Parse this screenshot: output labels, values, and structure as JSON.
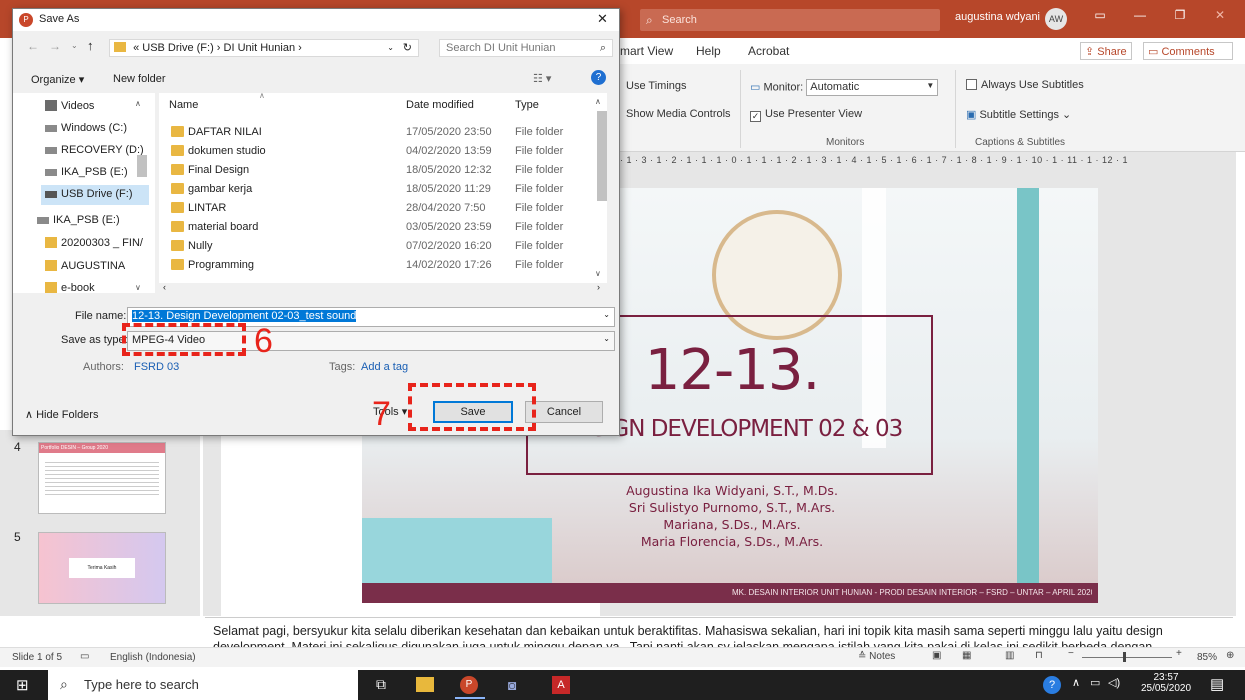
{
  "ppt": {
    "search_placeholder": "Search",
    "user_name": "augustina wdyani",
    "user_initials": "AW",
    "tabs": [
      "mart View",
      "Help",
      "Acrobat"
    ],
    "share": "Share",
    "comments": "Comments",
    "ribbon": {
      "use_timings": "Use Timings",
      "show_media_controls": "Show Media Controls",
      "monitor_label": "Monitor:",
      "monitor_value": "Automatic",
      "use_presenter_view": "Use Presenter View",
      "monitors_group": "Monitors",
      "always_use_subtitles": "Always Use Subtitles",
      "subtitle_settings": "Subtitle Settings",
      "captions_group": "Captions & Subtitles"
    },
    "ruler": "· 1 · 3 · 1 · 2 · 1 · 1 · 1 · 0 · 1 · 1 · 1 · 2 · 1 · 3 · 1 · 4 · 1 · 5 · 1 · 6 · 1 · 7 · 1 · 8 · 1 · 9 · 1 · 10 · 1 · 11 · 1 · 12 · 1",
    "thumbnails": [
      {
        "number": "4",
        "caption": "Portfolio DESIN – Group 2020"
      },
      {
        "number": "5",
        "caption": "Terima Kasih"
      }
    ],
    "slide": {
      "title": "12-13.",
      "subtitle": "DESIGN DEVELOPMENT 02 & 03",
      "authors": [
        "Augustina Ika Widyani, S.T., M.Ds.",
        "Sri Sulistyo Purnomo, S.T., M.Ars.",
        "Mariana, S.Ds., M.Ars.",
        "Maria Florencia, S.Ds., M.Ars."
      ],
      "footer": "MK. DESAIN INTERIOR UNIT HUNIAN - PRODI DESAIN INTERIOR – FSRD – UNTAR – APRIL 2020"
    },
    "notes_line1": "Selamat pagi, bersyukur kita selalu diberikan kesehatan dan kebaikan untuk beraktifitas. Mahasiswa sekalian, hari ini topik kita masih sama seperti minggu lalu yaitu design",
    "notes_line2": "development. Materi ini sekaligus digunakan juga untuk minggu depan ya.. Tapi nanti akan sy jelaskan mengapa istilah yang kita pakai di kelas ini sedikit berbeda dengan",
    "status": {
      "slide_info": "Slide 1 of 5",
      "language": "English (Indonesia)",
      "notes": "Notes",
      "zoom": "85%"
    }
  },
  "dialog": {
    "title": "Save As",
    "breadcrumb": [
      "«",
      "USB Drive (F:)",
      "DI Unit Hunian"
    ],
    "search_placeholder": "Search DI Unit Hunian",
    "organize": "Organize",
    "new_folder": "New folder",
    "nav_items": [
      "Videos",
      "Windows (C:)",
      "RECOVERY (D:)",
      "IKA_PSB (E:)",
      "USB Drive (F:)",
      "IKA_PSB (E:)",
      "20200303 _ FIN/",
      "AUGUSTINA",
      "e-book"
    ],
    "columns": {
      "name": "Name",
      "date": "Date modified",
      "type": "Type"
    },
    "files": [
      {
        "name": "DAFTAR NILAI",
        "date": "17/05/2020 23:50",
        "type": "File folder"
      },
      {
        "name": "dokumen studio",
        "date": "04/02/2020 13:59",
        "type": "File folder"
      },
      {
        "name": "Final Design",
        "date": "18/05/2020 12:32",
        "type": "File folder"
      },
      {
        "name": "gambar kerja",
        "date": "18/05/2020 11:29",
        "type": "File folder"
      },
      {
        "name": "LINTAR",
        "date": "28/04/2020 7:50",
        "type": "File folder"
      },
      {
        "name": "material board",
        "date": "03/05/2020 23:59",
        "type": "File folder"
      },
      {
        "name": "Nully",
        "date": "07/02/2020 16:20",
        "type": "File folder"
      },
      {
        "name": "Programming",
        "date": "14/02/2020 17:26",
        "type": "File folder"
      }
    ],
    "file_name_label": "File name:",
    "file_name_value": "12-13. Design Development 02-03_test sound",
    "save_as_type_label": "Save as type:",
    "save_as_type_value": "MPEG-4 Video",
    "authors_label": "Authors:",
    "authors_value": "FSRD 03",
    "tags_label": "Tags:",
    "tags_value": "Add a tag",
    "hide_folders": "Hide Folders",
    "tools": "Tools",
    "save": "Save",
    "cancel": "Cancel"
  },
  "annotations": {
    "step6": "6",
    "step7": "7"
  },
  "taskbar": {
    "search_placeholder": "Type here to search",
    "time": "23:57",
    "date": "25/05/2020"
  },
  "colors": {
    "ppt_accent": "#b7472a",
    "annotation": "#e8241b",
    "slide_frame": "#7a2040"
  }
}
